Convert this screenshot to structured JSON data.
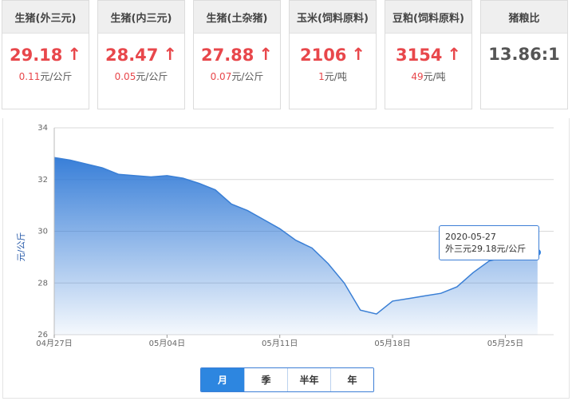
{
  "cards": [
    {
      "title": "生猪(外三元)",
      "price": "29.18",
      "arrow": "↑",
      "change": "0.11",
      "unit": "元/公斤"
    },
    {
      "title": "生猪(内三元)",
      "price": "28.47",
      "arrow": "↑",
      "change": "0.05",
      "unit": "元/公斤"
    },
    {
      "title": "生猪(土杂猪)",
      "price": "27.88",
      "arrow": "↑",
      "change": "0.07",
      "unit": "元/公斤"
    },
    {
      "title": "玉米(饲料原料)",
      "price": "2106",
      "arrow": "↑",
      "change": "1",
      "unit": "元/吨"
    },
    {
      "title": "豆粕(饲料原料)",
      "price": "3154",
      "arrow": "↑",
      "change": "49",
      "unit": "元/吨"
    },
    {
      "title": "猪粮比",
      "price": "13.86:1"
    }
  ],
  "colors": {
    "up": "#e8474b",
    "accent": "#2d86e0",
    "line": "#3a7fd5"
  },
  "chart_data": {
    "type": "area",
    "ylabel": "元/公斤",
    "ylim": [
      26,
      34
    ],
    "yticks": [
      26,
      28,
      30,
      32,
      34
    ],
    "xlim": [
      "2020-04-27",
      "2020-05-28"
    ],
    "xticks": [
      {
        "date": "2020-04-27",
        "label": "04月27日"
      },
      {
        "date": "2020-05-04",
        "label": "05月04日"
      },
      {
        "date": "2020-05-11",
        "label": "05月11日"
      },
      {
        "date": "2020-05-18",
        "label": "05月18日"
      },
      {
        "date": "2020-05-25",
        "label": "05月25日"
      }
    ],
    "grid": true,
    "series": [
      {
        "points": [
          {
            "x": "2020-04-27",
            "y": 32.85
          },
          {
            "x": "2020-04-28",
            "y": 32.75
          },
          {
            "x": "2020-04-29",
            "y": 32.6
          },
          {
            "x": "2020-04-30",
            "y": 32.45
          },
          {
            "x": "2020-05-01",
            "y": 32.2
          },
          {
            "x": "2020-05-02",
            "y": 32.15
          },
          {
            "x": "2020-05-03",
            "y": 32.1
          },
          {
            "x": "2020-05-04",
            "y": 32.15
          },
          {
            "x": "2020-05-05",
            "y": 32.05
          },
          {
            "x": "2020-05-06",
            "y": 31.85
          },
          {
            "x": "2020-05-07",
            "y": 31.6
          },
          {
            "x": "2020-05-08",
            "y": 31.05
          },
          {
            "x": "2020-05-09",
            "y": 30.8
          },
          {
            "x": "2020-05-10",
            "y": 30.45
          },
          {
            "x": "2020-05-11",
            "y": 30.1
          },
          {
            "x": "2020-05-12",
            "y": 29.65
          },
          {
            "x": "2020-05-13",
            "y": 29.35
          },
          {
            "x": "2020-05-14",
            "y": 28.75
          },
          {
            "x": "2020-05-15",
            "y": 28.0
          },
          {
            "x": "2020-05-16",
            "y": 26.95
          },
          {
            "x": "2020-05-17",
            "y": 26.8
          },
          {
            "x": "2020-05-18",
            "y": 27.3
          },
          {
            "x": "2020-05-19",
            "y": 27.4
          },
          {
            "x": "2020-05-20",
            "y": 27.5
          },
          {
            "x": "2020-05-21",
            "y": 27.6
          },
          {
            "x": "2020-05-22",
            "y": 27.85
          },
          {
            "x": "2020-05-23",
            "y": 28.4
          },
          {
            "x": "2020-05-24",
            "y": 28.85
          },
          {
            "x": "2020-05-25",
            "y": 29.0
          },
          {
            "x": "2020-05-26",
            "y": 29.1
          },
          {
            "x": "2020-05-27",
            "y": 29.18
          }
        ]
      }
    ],
    "tooltip": {
      "date": "2020-05-27",
      "text": "外三元29.18元/公斤"
    }
  },
  "range_tabs": [
    {
      "label": "月",
      "active": true
    },
    {
      "label": "季",
      "active": false
    },
    {
      "label": "半年",
      "active": false
    },
    {
      "label": "年",
      "active": false
    }
  ]
}
